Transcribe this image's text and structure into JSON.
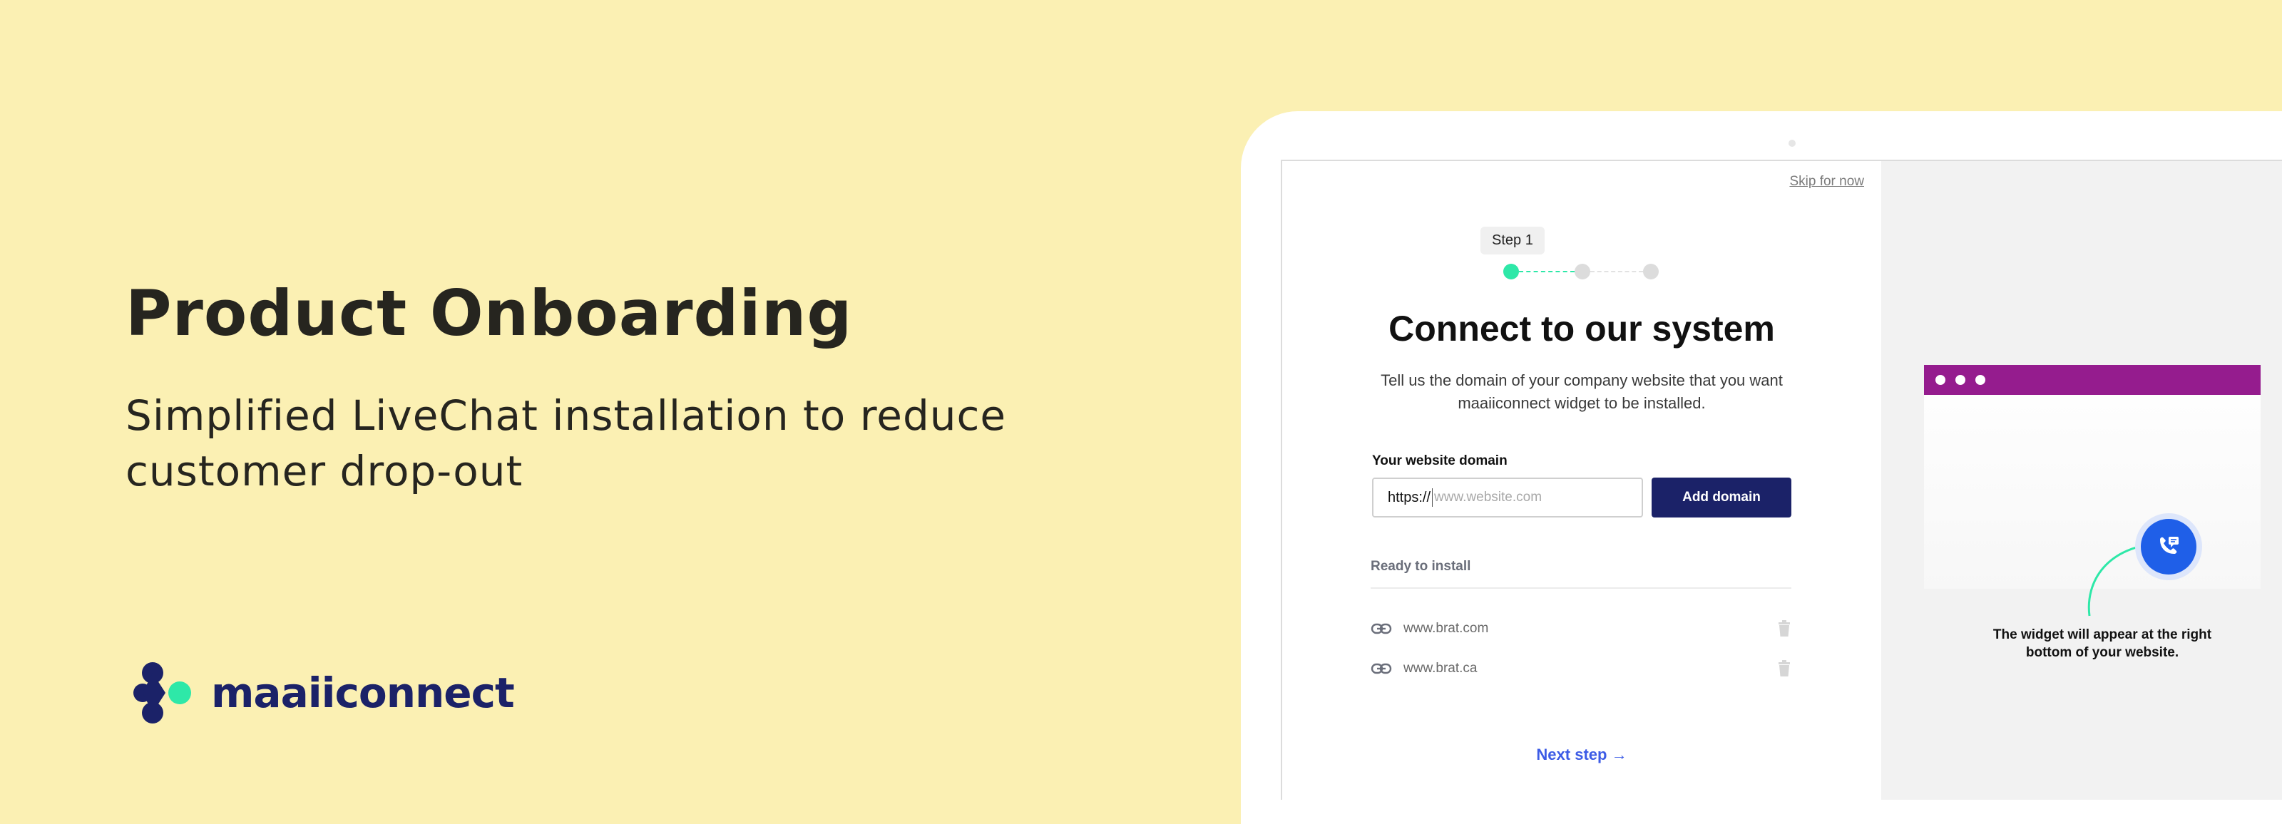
{
  "hero": {
    "title": "Product Onboarding",
    "subtitle": "Simplified LiveChat installation to reduce customer drop-out"
  },
  "brand": {
    "name": "maaiiconnect",
    "colors": {
      "navy": "#1b2268",
      "mint": "#2ee8a8",
      "background": "#fbf0b3"
    }
  },
  "onboarding": {
    "skip_label": "Skip for now",
    "step_label": "Step 1",
    "stepper": {
      "current": 1,
      "total": 3
    },
    "title": "Connect to our system",
    "description": "Tell us the domain of your company website that you want maaiiconnect widget to be installed.",
    "domain_field": {
      "label": "Your website domain",
      "prefix": "https://",
      "placeholder": "www.website.com",
      "value": ""
    },
    "add_button": "Add domain",
    "ready_label": "Ready to install",
    "domains": [
      {
        "url": "www.brat.com"
      },
      {
        "url": "www.brat.ca"
      }
    ],
    "next_step": "Next step →"
  },
  "preview": {
    "header_color": "#951c8e",
    "widget_color": "#1f5fe8",
    "caption": "The widget will appear at the right bottom of your website."
  }
}
